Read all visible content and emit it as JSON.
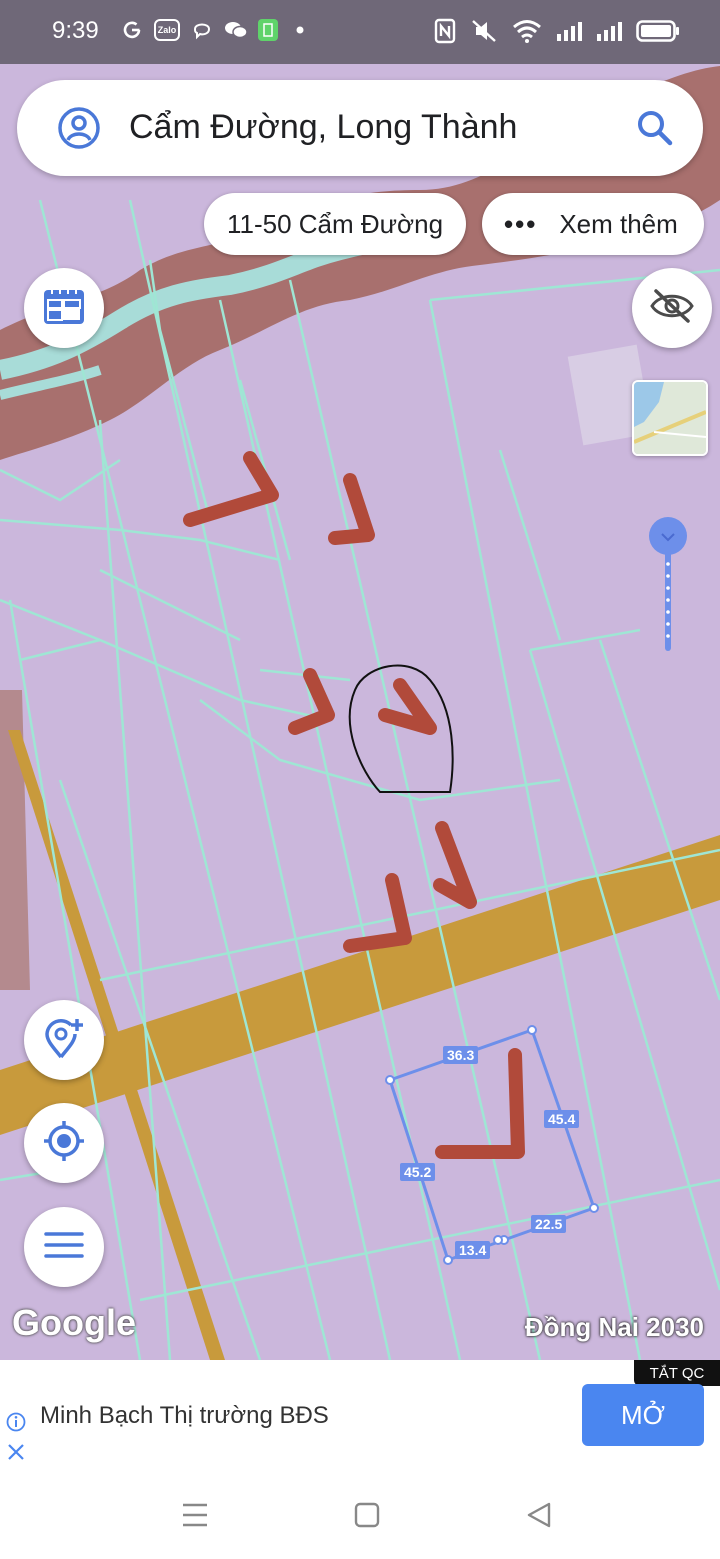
{
  "status_bar": {
    "time": "9:39",
    "left_icons": [
      "google-icon",
      "zalo-icon",
      "viber-icon",
      "wechat-icon",
      "battery-saver-icon",
      "dot-icon"
    ],
    "zalo_label": "Zalo",
    "right_icons": [
      "nfc-icon",
      "mute-icon",
      "wifi-icon",
      "signal-icon",
      "signal-icon",
      "battery-icon"
    ]
  },
  "search": {
    "query": "Cẩm Đường, Long Thành"
  },
  "chips": {
    "address": "11-50 Cẩm Đường",
    "more": "Xem thêm"
  },
  "map": {
    "measurements": [
      "36.3",
      "45.4",
      "45.2",
      "22.5",
      "13.4"
    ],
    "logo": "Google",
    "overlay_name": "Đồng Nai 2030",
    "colors": {
      "land": "#cbb7dc",
      "parcel_border": "#9fe6d4",
      "road": "#c89a3c",
      "river": "#a8dcd8",
      "riverbank": "#a8706e",
      "annotation": "#b14a3a",
      "measure": "#6d8fea"
    }
  },
  "ad": {
    "badge": "TẮT QC",
    "text": "Minh Bạch Thị trường BĐS",
    "button": "MỞ"
  },
  "nav": {
    "buttons": [
      "recent-apps",
      "home",
      "back"
    ]
  }
}
